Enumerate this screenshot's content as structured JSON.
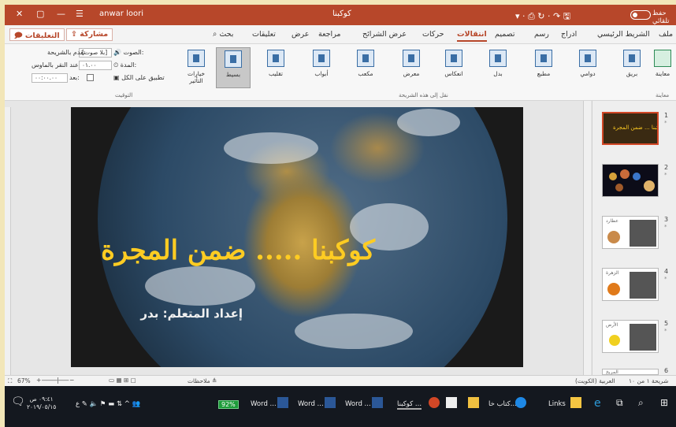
{
  "titlebar": {
    "autosave": "حفظ تلقائي",
    "filename": "كوكبنا",
    "username": "anwar loori"
  },
  "tabs": {
    "items": [
      "ملف",
      "الشريط الرئيسي",
      "ادراج",
      "رسم",
      "تصميم",
      "انتقالات",
      "حركات",
      "عرض الشرائح",
      "مراجعة",
      "عرض",
      "تعليقات",
      "بحث"
    ],
    "share": "مشاركة",
    "comments": "التعليقات"
  },
  "ribbon": {
    "preview": "معاينة",
    "transitions": [
      "بريق",
      "دوامي",
      "مطبع",
      "بدل",
      "انعكاس",
      "معرض",
      "مكعب",
      "أبواب",
      "تقليب",
      "بسيط"
    ],
    "effect_options": "خيارات التأثير",
    "group_transitions": "نقل إلى هذه الشريحة",
    "group_preview": "معاينة",
    "sound_label": "الصوت:",
    "sound_value": "[بلا صوت]",
    "duration_label": "المدة:",
    "duration_value": "٠١.٠٠",
    "apply_all": "تطبيق على الكل",
    "advance_label": "تقدم بالشريحة",
    "on_click": "عند النقر بالماوس",
    "after_label": "بعد:",
    "after_value": "٠٠:٠٠.٠٠",
    "group_timing": "التوقيت"
  },
  "slide": {
    "title": "كوكبنا ..... ضمن المجرة",
    "subtitle": "إعداد المتعلم: بدر"
  },
  "thumbnails": [
    {
      "num": "1",
      "caption": "كوكبنا ... ضمن المجرة"
    },
    {
      "num": "2",
      "caption": ""
    },
    {
      "num": "3",
      "caption": "عطارد"
    },
    {
      "num": "4",
      "caption": "الزهرة"
    },
    {
      "num": "5",
      "caption": "الأرض"
    },
    {
      "num": "6",
      "caption": "المريخ"
    }
  ],
  "status": {
    "slide_info": "شريحة ١ من ١٠",
    "language": "العربية (الكويت)",
    "zoom": "67%",
    "notes": "ملاحظات"
  },
  "taskbar": {
    "time": "٠٩:٤١ ص",
    "date": "٢٠١٩/٠٥/١٥",
    "battery": "92%",
    "apps": [
      "Word ...",
      "Word ...",
      "Word ...",
      "كوكبنا ...",
      "كتاب خا...",
      "Links"
    ]
  },
  "colors": {
    "accent": "#b7472a",
    "slide_title": "#ffcc22",
    "taskbar": "#14181f"
  }
}
